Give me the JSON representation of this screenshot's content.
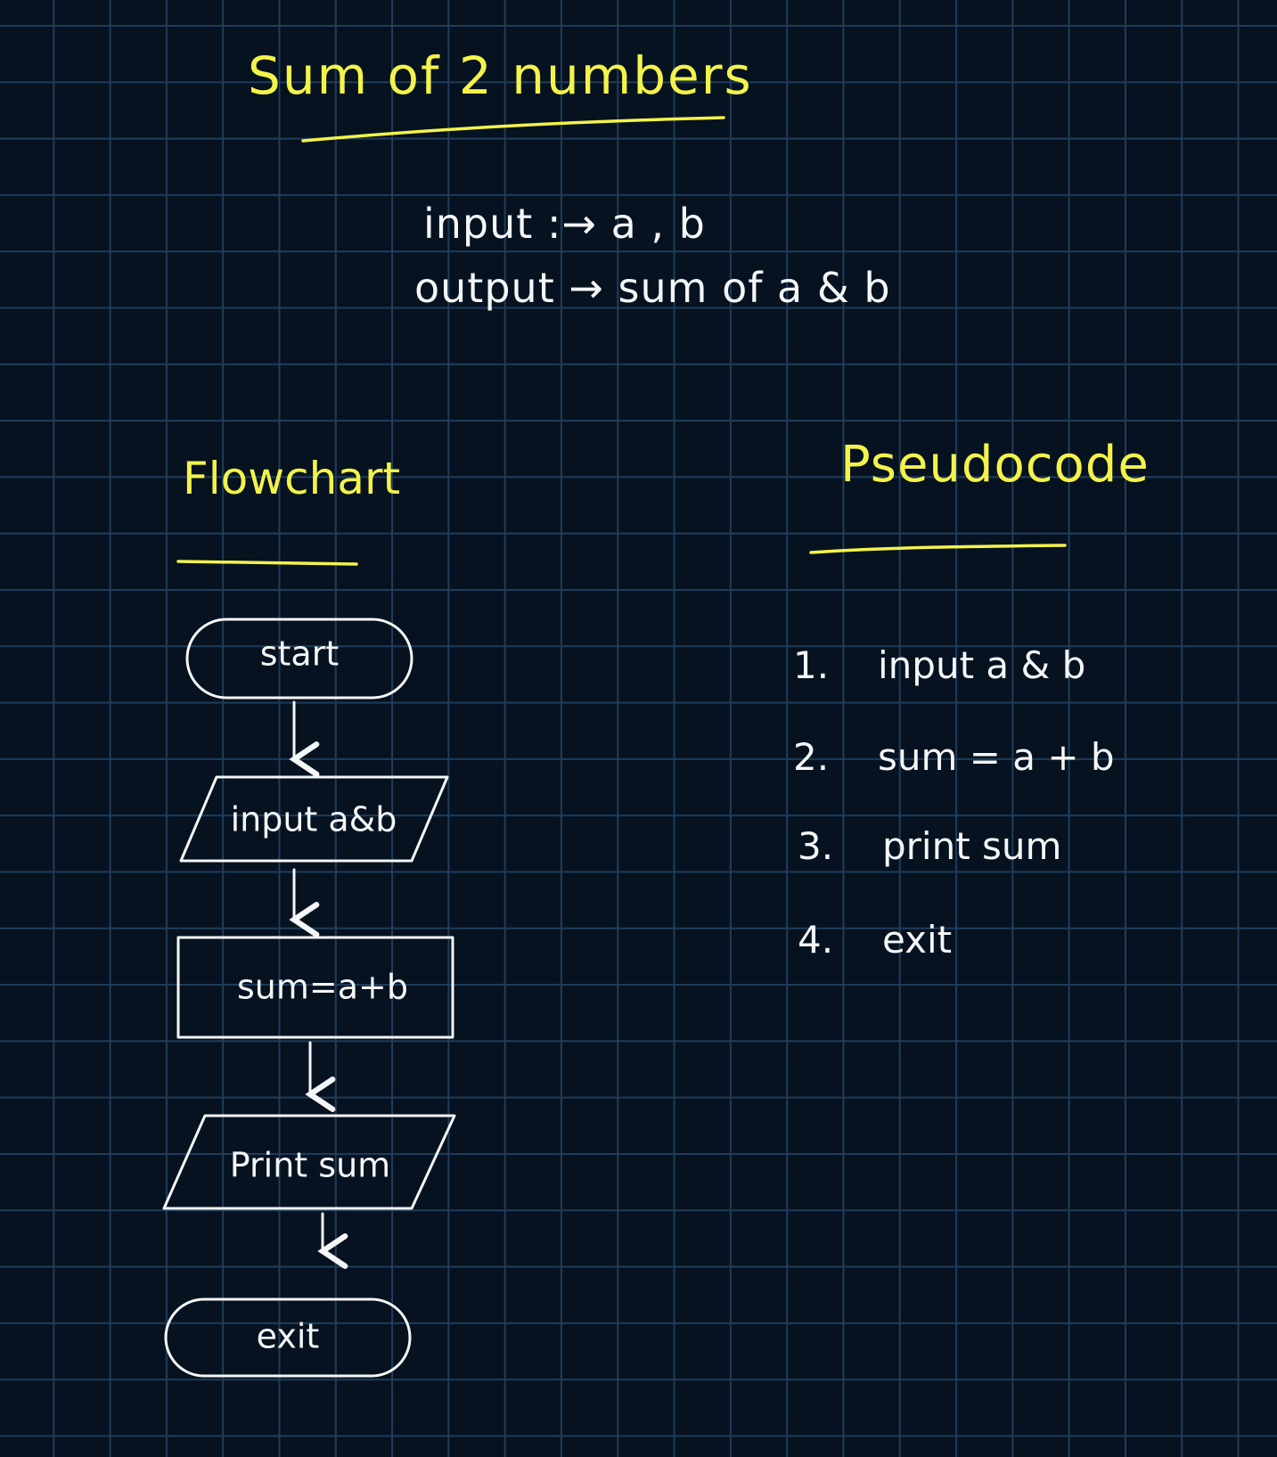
{
  "title": "Sum of 2 numbers",
  "io": {
    "input": "input :→  a , b",
    "output": "output → sum of  a & b"
  },
  "flowchart": {
    "heading": "Flowchart",
    "nodes": [
      {
        "shape": "terminal",
        "label": "start"
      },
      {
        "shape": "io",
        "label": "input a&b"
      },
      {
        "shape": "process",
        "label": "sum=a+b"
      },
      {
        "shape": "io",
        "label": "Print sum"
      },
      {
        "shape": "terminal",
        "label": "exit"
      }
    ]
  },
  "pseudocode": {
    "heading": "Pseudocode",
    "steps": [
      {
        "num": "1.",
        "text": "input  a & b"
      },
      {
        "num": "2.",
        "text": "sum  =  a + b"
      },
      {
        "num": "3.",
        "text": "print  sum"
      },
      {
        "num": "4.",
        "text": "exit"
      }
    ]
  },
  "colors": {
    "background": "#06121f",
    "grid": "#1f3d5c",
    "heading": "#f3f34a",
    "ink": "#f4f6f8"
  }
}
